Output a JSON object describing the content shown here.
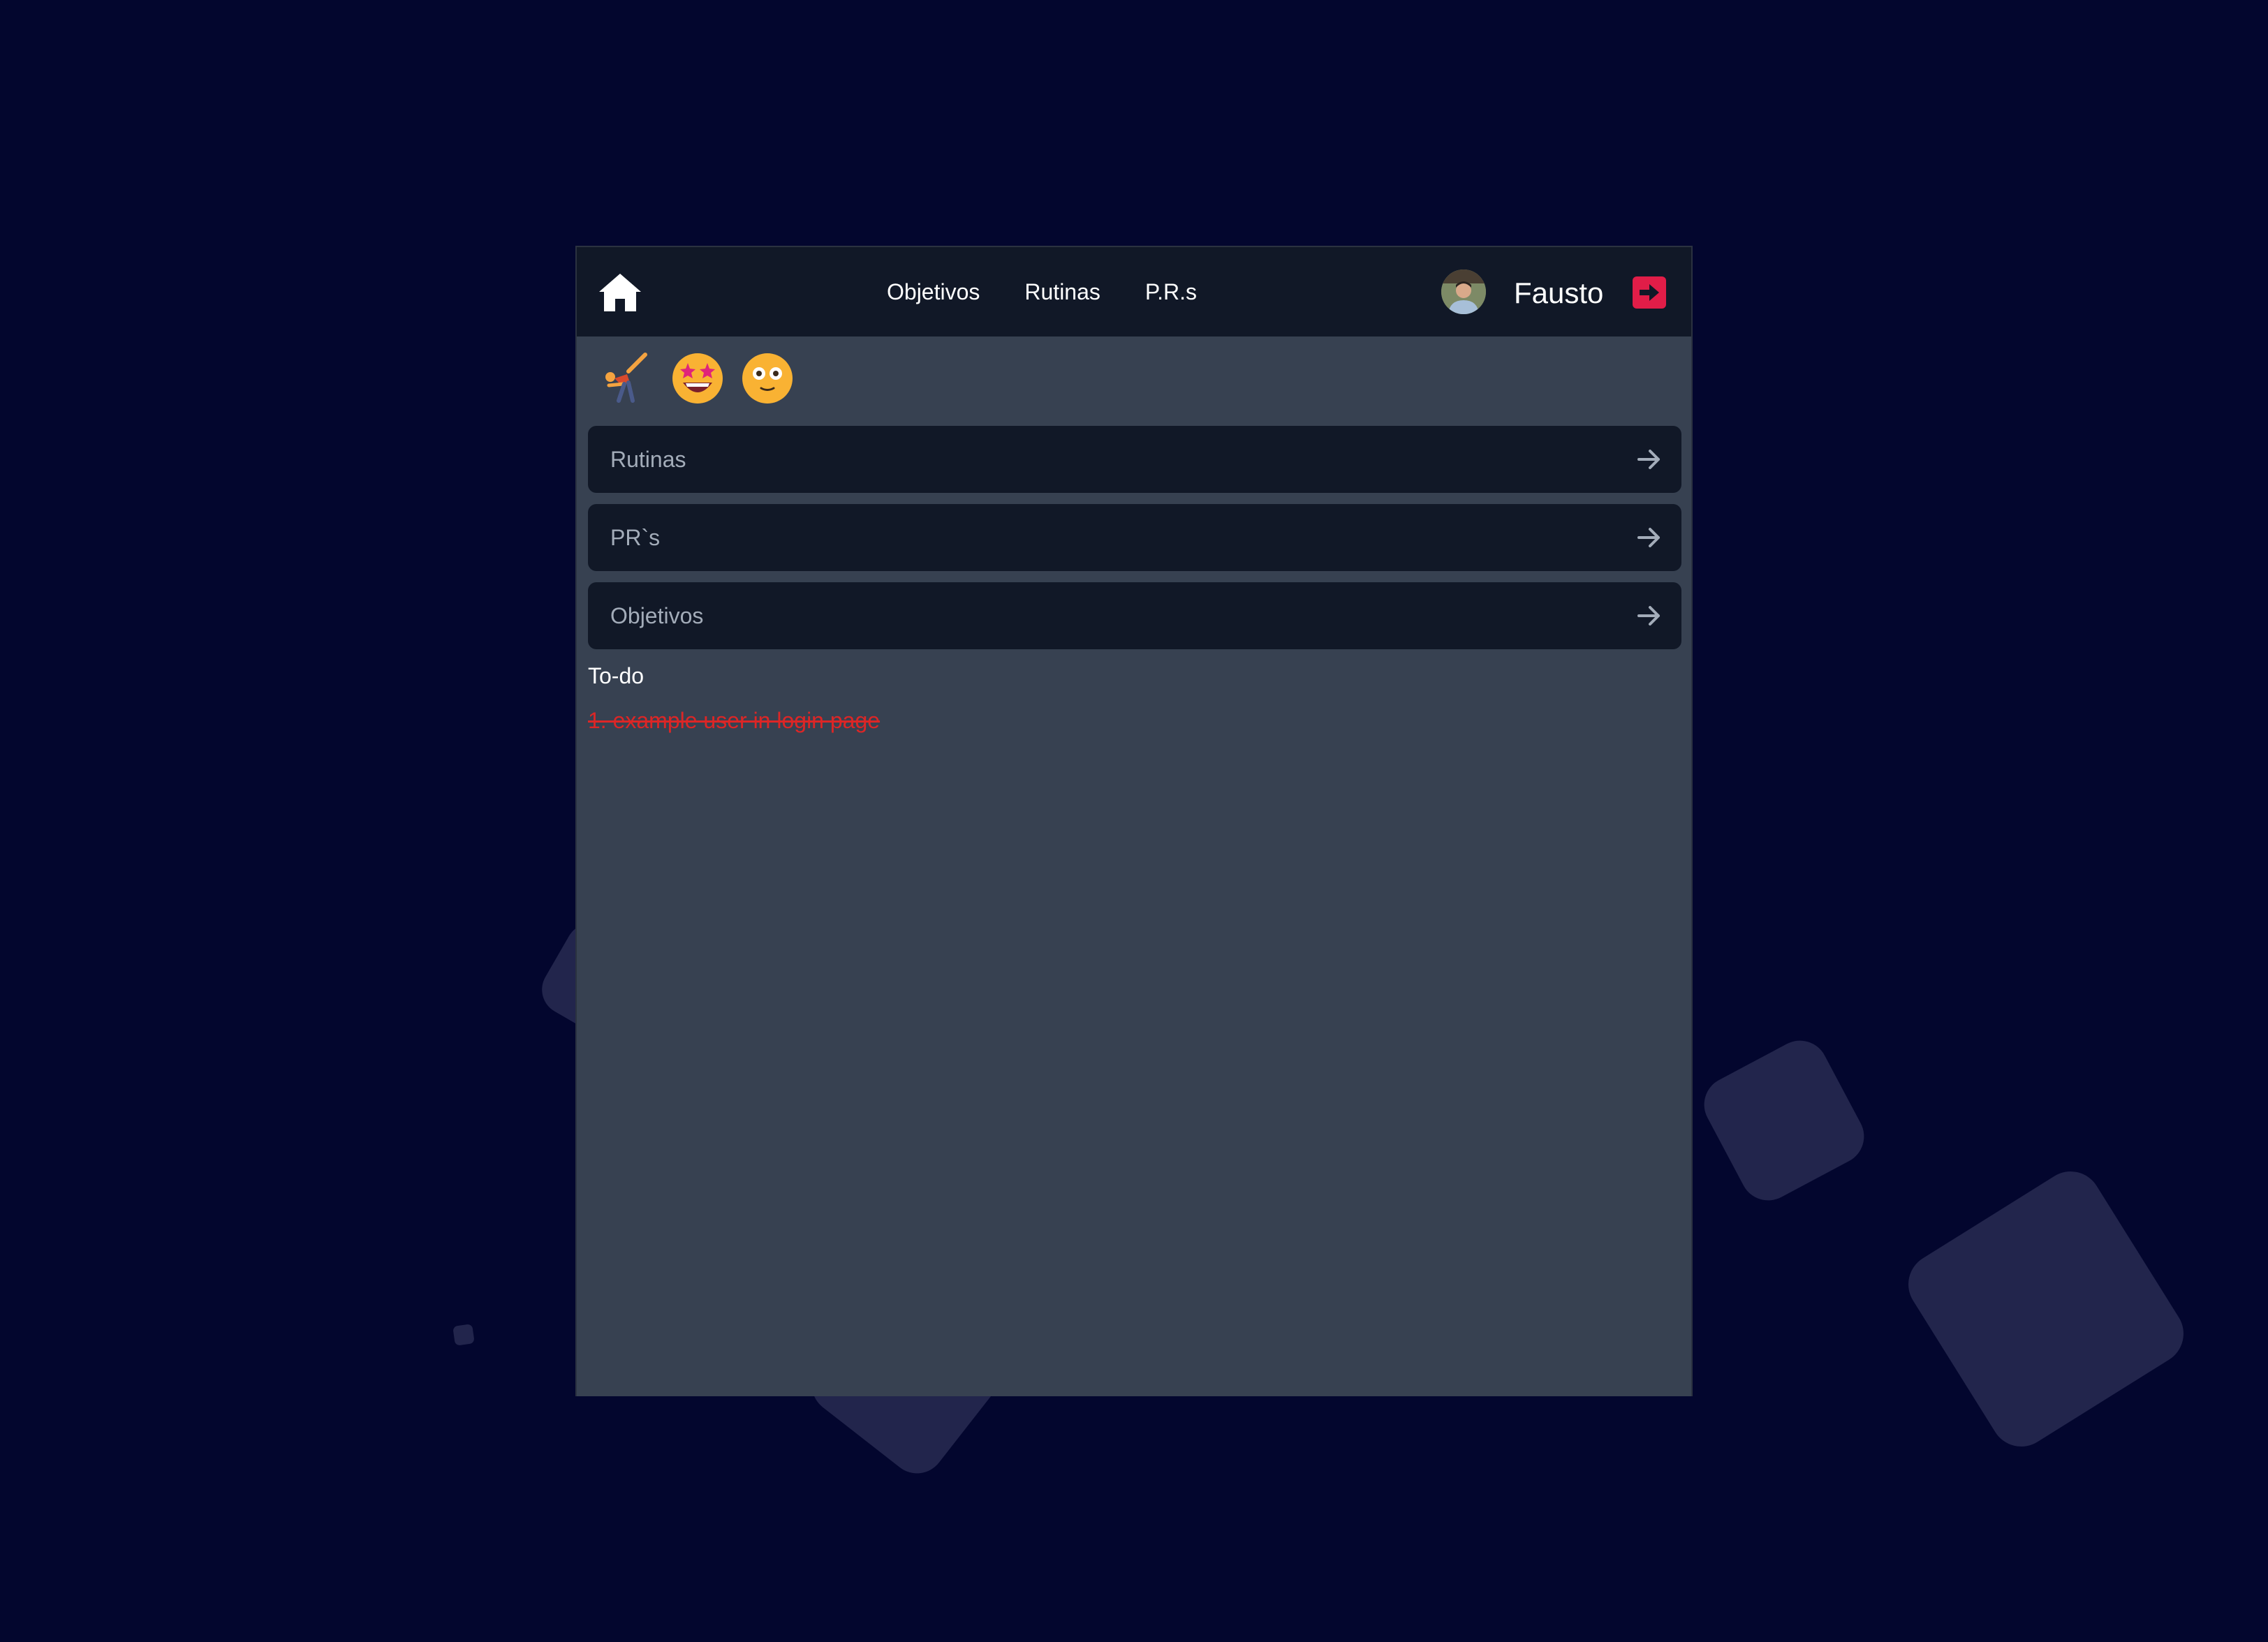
{
  "colors": {
    "page_background": "#03062e",
    "panel_background": "#374151",
    "navbar_background": "#111827",
    "card_background": "#111827",
    "logout_accent": "#e11d48",
    "todo_done_color": "#dc2626"
  },
  "navbar": {
    "home_icon": "home-icon",
    "links": [
      {
        "label": "Objetivos"
      },
      {
        "label": "Rutinas"
      },
      {
        "label": "P.R.s"
      }
    ],
    "user": {
      "name": "Fausto",
      "avatar_icon": "user-avatar",
      "logout_icon": "logout-icon"
    }
  },
  "emojis": [
    {
      "icon": "person-cartwheeling-emoji"
    },
    {
      "icon": "star-struck-emoji"
    },
    {
      "icon": "flushed-face-emoji"
    }
  ],
  "menu": {
    "items": [
      {
        "label": "Rutinas",
        "icon": "arrow-right-icon"
      },
      {
        "label": "PR`s",
        "icon": "arrow-right-icon"
      },
      {
        "label": "Objetivos",
        "icon": "arrow-right-icon"
      }
    ]
  },
  "todo": {
    "title": "To-do",
    "items": [
      {
        "text": "1. example user in login page",
        "done": true
      }
    ]
  }
}
